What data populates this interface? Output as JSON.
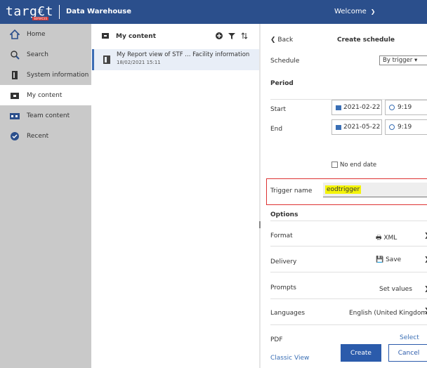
{
  "topbar": {
    "logo": "targ€t",
    "logo_sub": "SERVICES",
    "app_title": "Data Warehouse",
    "welcome": "Welcome"
  },
  "sidebar": {
    "items": [
      {
        "label": "Home",
        "icon": "home-icon"
      },
      {
        "label": "Search",
        "icon": "search-icon"
      },
      {
        "label": "System information",
        "icon": "document-icon"
      },
      {
        "label": "My content",
        "icon": "my-content-icon"
      },
      {
        "label": "Team content",
        "icon": "team-content-icon"
      },
      {
        "label": "Recent",
        "icon": "recent-icon"
      }
    ]
  },
  "content": {
    "title": "My content",
    "item": {
      "title": "My Report view of STF ... Facility information",
      "date": "18/02/2021 15:11"
    }
  },
  "panel": {
    "back": "Back",
    "title": "Create schedule",
    "schedule_label": "Schedule",
    "schedule_value": "By trigger",
    "period_label": "Period",
    "start_label": "Start",
    "start_date": "2021-02-22",
    "start_time": "9:19",
    "end_label": "End",
    "end_date": "2021-05-22",
    "end_time": "9:19",
    "no_end_date": "No end date",
    "trigger_label": "Trigger name",
    "trigger_value": "eodtrigger",
    "options_label": "Options",
    "format_label": "Format",
    "format_value": "XML",
    "delivery_label": "Delivery",
    "delivery_value": "Save",
    "prompts_label": "Prompts",
    "prompts_value": "Set values",
    "languages_label": "Languages",
    "languages_value": "English (United Kingdom)",
    "pdf_label": "PDF",
    "pdf_value": "Select",
    "classic_view": "Classic View",
    "create": "Create",
    "cancel": "Cancel"
  },
  "colors": {
    "topbar": "#2b4f8c",
    "accent": "#2b5bab",
    "highlight": "#f4f40a",
    "trigger_border": "#d33"
  }
}
